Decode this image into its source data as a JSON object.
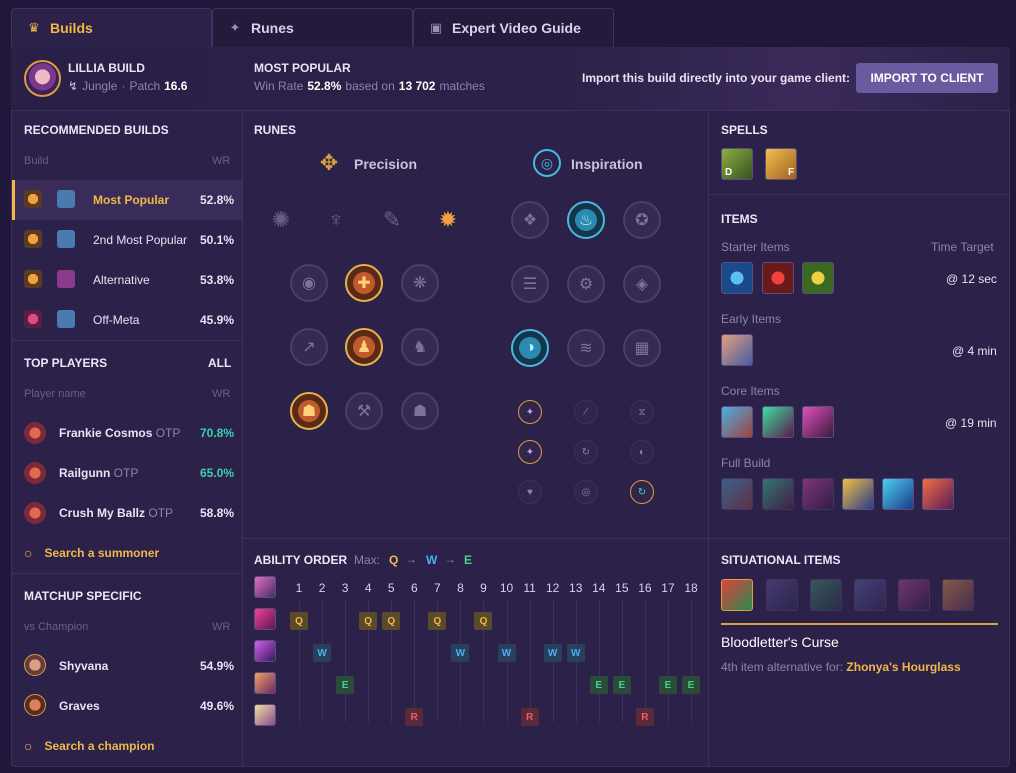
{
  "tabs": [
    {
      "label": "Builds"
    },
    {
      "label": "Runes"
    },
    {
      "label": "Expert Video Guide"
    }
  ],
  "header": {
    "champion_title": "LILLIA BUILD",
    "role": "Jungle",
    "patch_label": "Patch",
    "patch": "16.6",
    "section": "MOST POPULAR",
    "winrate_label": "Win Rate",
    "winrate": "52.8%",
    "based_on": "based on",
    "matches": "13 702",
    "matches_label": "matches",
    "import_prompt": "Import this build directly into your game client:",
    "import_button": "IMPORT TO CLIENT"
  },
  "recommended": {
    "title": "RECOMMENDED BUILDS",
    "col_build": "Build",
    "col_wr": "WR",
    "rows": [
      {
        "name": "Most Popular",
        "wr": "52.8%"
      },
      {
        "name": "2nd Most Popular",
        "wr": "50.1%"
      },
      {
        "name": "Alternative",
        "wr": "53.8%"
      },
      {
        "name": "Off-Meta",
        "wr": "45.9%"
      }
    ]
  },
  "top_players": {
    "title": "TOP PLAYERS",
    "all": "ALL",
    "col_name": "Player name",
    "col_wr": "WR",
    "rows": [
      {
        "name": "Frankie Cosmos",
        "tag": "OTP",
        "wr": "70.8%",
        "color": "#3ad0b0"
      },
      {
        "name": "Railgunn",
        "tag": "OTP",
        "wr": "65.0%",
        "color": "#3ad0b0"
      },
      {
        "name": "Crush My Ballz",
        "tag": "OTP",
        "wr": "58.8%",
        "color": "#e8e3f4"
      }
    ],
    "search": "Search a summoner"
  },
  "matchup": {
    "title": "MATCHUP SPECIFIC",
    "col_vs": "vs Champion",
    "col_wr": "WR",
    "rows": [
      {
        "name": "Shyvana",
        "wr": "54.9%"
      },
      {
        "name": "Graves",
        "wr": "49.6%"
      }
    ],
    "search": "Search a champion"
  },
  "runes": {
    "title": "RUNES",
    "primary": "Precision",
    "secondary": "Inspiration"
  },
  "spells": {
    "title": "SPELLS",
    "keys": [
      "D",
      "F"
    ]
  },
  "items": {
    "title": "ITEMS",
    "starter": "Starter Items",
    "time_target": "Time Target",
    "starter_time": "@ 12 sec",
    "early": "Early Items",
    "early_time": "@ 4 min",
    "core": "Core Items",
    "core_time": "@ 19 min",
    "full": "Full Build"
  },
  "ability": {
    "title": "ABILITY ORDER",
    "max_label": "Max:",
    "max": [
      "Q",
      "W",
      "E"
    ],
    "levels": [
      "1",
      "2",
      "3",
      "4",
      "5",
      "6",
      "7",
      "8",
      "9",
      "10",
      "11",
      "12",
      "13",
      "14",
      "15",
      "16",
      "17",
      "18"
    ]
  },
  "situational": {
    "title": "SITUATIONAL ITEMS",
    "item_name": "Bloodletter's Curse",
    "alt_label": "4th item alternative for:",
    "alt_item": "Zhonya's Hourglass"
  },
  "colors": {
    "accent": "#f0b84a",
    "panel": "#2c2148",
    "bg": "#21173a",
    "button": "#6a5aa0"
  }
}
